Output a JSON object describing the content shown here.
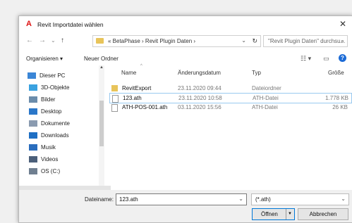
{
  "window": {
    "title": "Revit Importdatei wählen",
    "close_glyph": "✕"
  },
  "nav": {
    "back_glyph": "←",
    "forward_glyph": "→",
    "recent_glyph": "⌄",
    "up_glyph": "↑",
    "address": "« BetaPhase › Revit Plugin Daten ›",
    "address_chevron": "⌄",
    "refresh_glyph": "↻",
    "search_placeholder": "\"Revit Plugin Daten\" durchsu...",
    "search_glyph": "⌕"
  },
  "toolbar": {
    "organize": "Organisieren ▾",
    "new_folder": "Neuer Ordner",
    "view_glyph": "☷ ▾",
    "pane_glyph": "▭",
    "help_glyph": "?"
  },
  "sidebar": {
    "items": [
      {
        "label": "Dieser PC",
        "icon": "computer-icon",
        "color": "#3b86d6"
      },
      {
        "label": "3D-Objekte",
        "icon": "3d-objects-icon",
        "color": "#3aa2e0"
      },
      {
        "label": "Bilder",
        "icon": "pictures-icon",
        "color": "#6b8cab"
      },
      {
        "label": "Desktop",
        "icon": "desktop-icon",
        "color": "#2a77c9"
      },
      {
        "label": "Dokumente",
        "icon": "documents-icon",
        "color": "#8a9bb0"
      },
      {
        "label": "Downloads",
        "icon": "downloads-icon",
        "color": "#1f6fc4"
      },
      {
        "label": "Musik",
        "icon": "music-icon",
        "color": "#2a6dbd"
      },
      {
        "label": "Videos",
        "icon": "videos-icon",
        "color": "#4b5f7a"
      },
      {
        "label": "OS (C:)",
        "icon": "drive-icon",
        "color": "#6f7f90"
      }
    ]
  },
  "list": {
    "headers": {
      "name": "Name",
      "date": "Änderungsdatum",
      "type": "Typ",
      "size": "Größe"
    },
    "rows": [
      {
        "name": "RevitExport",
        "date": "23.11.2020 09:44",
        "type": "Dateiordner",
        "size": "",
        "kind": "folder"
      },
      {
        "name": "123.ath",
        "date": "23.11.2020 10:58",
        "type": "ATH-Datei",
        "size": "1.778 KB",
        "kind": "file"
      },
      {
        "name": "ATH-POS-001.ath",
        "date": "03.11.2020 15:56",
        "type": "ATH-Datei",
        "size": "26 KB",
        "kind": "file"
      }
    ]
  },
  "bottom": {
    "filename_label": "Dateiname:",
    "filename_value": "123.ath",
    "filter_value": "(*.ath)",
    "open_label": "Öffnen",
    "cancel_label": "Abbrechen",
    "chevron": "⌄"
  },
  "colors": {
    "accent": "#0078d7",
    "folder": "#e8c45a",
    "app_logo": "#dd1111"
  }
}
